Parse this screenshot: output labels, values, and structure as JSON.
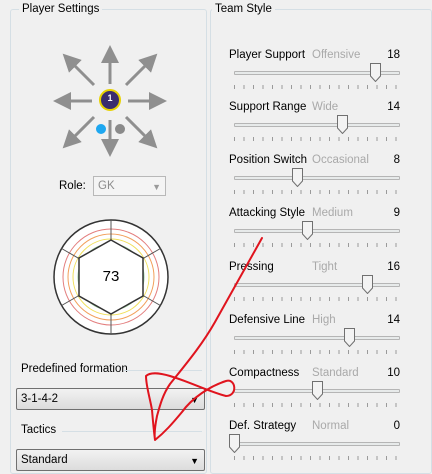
{
  "player_settings": {
    "title": "Player Settings",
    "player_marker_number": "1",
    "role_label": "Role:",
    "role_value": "GK",
    "rating": "73",
    "predefined_formation_label": "Predefined formation",
    "formation_value": "3-1-4-2",
    "tactics_label": "Tactics",
    "tactics_value": "Standard"
  },
  "team_style": {
    "title": "Team Style",
    "sliders": [
      {
        "label": "Player Support",
        "descriptor": "Offensive",
        "value": 18,
        "level": 0.85
      },
      {
        "label": "Support Range",
        "descriptor": "Wide",
        "value": 14,
        "level": 0.65
      },
      {
        "label": "Position Switch",
        "descriptor": "Occasional",
        "value": 8,
        "level": 0.38
      },
      {
        "label": "Attacking Style",
        "descriptor": "Medium",
        "value": 9,
        "level": 0.44
      },
      {
        "label": "Pressing",
        "descriptor": "Tight",
        "value": 16,
        "level": 0.8
      },
      {
        "label": "Defensive Line",
        "descriptor": "High",
        "value": 14,
        "level": 0.69
      },
      {
        "label": "Compactness",
        "descriptor": "Standard",
        "value": 10,
        "level": 0.5
      },
      {
        "label": "Def. Strategy",
        "descriptor": "Normal",
        "value": 0,
        "level": 0.0
      }
    ]
  },
  "icons": {
    "arrows": "direction-arrow-icon",
    "player_marker": "player-marker-icon",
    "combo_arrow": "chevron-down-icon"
  },
  "colors": {
    "marker_fill": "#3a2d6e",
    "marker_ring": "#e8d200",
    "dot_blue": "#1ea7f0",
    "dot_gray": "#8a8a8a",
    "scribble": "#e0141e"
  }
}
